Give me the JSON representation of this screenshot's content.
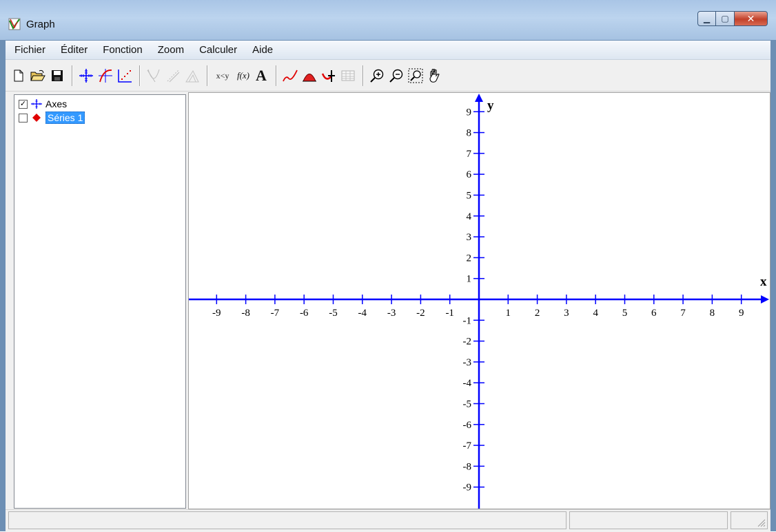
{
  "window": {
    "title": "Graph"
  },
  "menu": [
    "Fichier",
    "Éditer",
    "Fonction",
    "Zoom",
    "Calculer",
    "Aide"
  ],
  "toolbar": {
    "icons": [
      "new-file-icon",
      "open-folder-icon",
      "save-icon",
      "axes-icon",
      "insert-function-icon",
      "point-series-icon",
      "tangent-icon",
      "shading-icon",
      "relation-icon",
      "text-xy-icon",
      "function-fx-icon",
      "text-label-icon",
      "trendline-icon",
      "evaluate-area-icon",
      "table-icon",
      "zoom-in-icon",
      "zoom-out-icon",
      "zoom-window-icon",
      "pan-hand-icon"
    ],
    "text_xy": "x<y",
    "text_fx": "f(x)",
    "text_a": "A"
  },
  "tree": [
    {
      "label": "Axes",
      "checked": true,
      "icon": "axes-icon"
    },
    {
      "label": "Séries 1",
      "checked": false,
      "selected": true,
      "icon": "red-diamond-icon",
      "color": "#e00000"
    }
  ],
  "chart_data": {
    "type": "scatter",
    "xlabel": "x",
    "ylabel": "y",
    "xlim": [
      -9,
      9
    ],
    "ylim": [
      -9,
      9
    ],
    "x_ticks": [
      -9,
      -8,
      -7,
      -6,
      -5,
      -4,
      -3,
      -2,
      -1,
      1,
      2,
      3,
      4,
      5,
      6,
      7,
      8,
      9
    ],
    "y_ticks": [
      9,
      8,
      7,
      6,
      5,
      4,
      3,
      2,
      1,
      -1,
      -2,
      -3,
      -4,
      -5,
      -6,
      -7,
      -8,
      -9
    ],
    "axis_color": "#0000ff",
    "grid": false,
    "series": []
  }
}
